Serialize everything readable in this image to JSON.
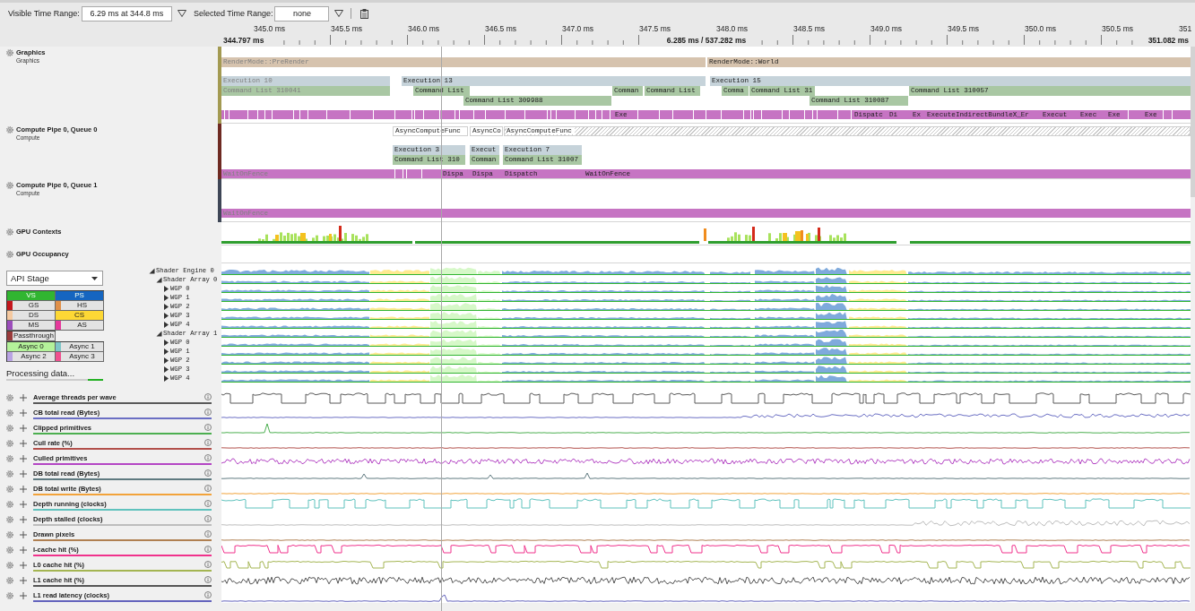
{
  "toolbar": {
    "visible_range": {
      "label": "Visible Time Range:",
      "value": "6.29 ms at 344.8 ms"
    },
    "selected_range": {
      "label": "Selected Time Range:",
      "value": "none"
    }
  },
  "ruler": {
    "ticks": [
      "345.0 ms",
      "345.5 ms",
      "346.0 ms",
      "346.5 ms",
      "347.0 ms",
      "347.5 ms",
      "348.0 ms",
      "348.5 ms",
      "349.0 ms",
      "349.5 ms",
      "350.0 ms",
      "350.5 ms",
      "351"
    ],
    "start": "344.797 ms",
    "span": "6.285 ms / 537.282 ms",
    "end": "351.082 ms"
  },
  "tracks": [
    {
      "kind": "queue",
      "title": "Graphics",
      "subtitle": "Graphics",
      "color": "#a39a52",
      "lanes": [
        {
          "kind": "marker",
          "events": [
            {
              "label": "RenderMode::PreRender",
              "faded": true
            },
            {
              "label": "RenderMode::World",
              "faded": false
            }
          ]
        },
        {
          "kind": "execution",
          "events": [
            {
              "label": "Execution 10",
              "faded": true
            },
            {
              "label": "Execution 13",
              "faded": false
            },
            {
              "label": "Execution 15",
              "faded": false
            }
          ]
        },
        {
          "kind": "command_list",
          "events": [
            {
              "label": "Command List 310041",
              "faded": true
            },
            {
              "label": "Command List",
              "faded": false
            },
            {
              "label": "Comman",
              "faded": false
            },
            {
              "label": "Command List",
              "faded": false
            },
            {
              "label": "Comma",
              "faded": false
            },
            {
              "label": "Command List 31",
              "faded": false
            },
            {
              "label": "Command List 310057",
              "faded": false
            }
          ]
        },
        {
          "kind": "command_list",
          "events": [
            {
              "label": "Command List 309988",
              "faded": false
            },
            {
              "label": "Command List 310087",
              "faded": false
            }
          ]
        },
        {
          "kind": "event",
          "events": [
            {
              "label": "Exe",
              "faded": false
            },
            {
              "label": "Dispatc",
              "faded": false
            },
            {
              "label": "Di",
              "faded": false
            },
            {
              "label": "Ex",
              "faded": false
            },
            {
              "label": "ExecuteIndirectBundleX_Er",
              "faded": false
            },
            {
              "label": "Execut",
              "faded": false
            },
            {
              "label": "Exec",
              "faded": false
            },
            {
              "label": "Exe",
              "faded": false
            },
            {
              "label": "Exe",
              "faded": false
            }
          ]
        }
      ]
    },
    {
      "kind": "queue",
      "title": "Compute Pipe 0, Queue 0",
      "subtitle": "Compute",
      "color": "#6e2a22",
      "lanes": [
        {
          "kind": "queue_function",
          "events": [
            {
              "label": "AsyncComputeFunc",
              "faded": false,
              "hatched": false
            },
            {
              "label": "AsyncCo",
              "faded": false,
              "hatched": false
            },
            {
              "label": "AsyncComputeFunc",
              "faded": false,
              "hatched": true
            }
          ]
        },
        {
          "kind": "execution",
          "events": [
            {
              "label": "Execution 3",
              "faded": false
            },
            {
              "label": "Execut",
              "faded": false
            },
            {
              "label": "Execution 7",
              "faded": false
            }
          ]
        },
        {
          "kind": "command_list",
          "events": [
            {
              "label": "Command List 310",
              "faded": false
            },
            {
              "label": "Comman",
              "faded": false
            },
            {
              "label": "Command List 31007",
              "faded": false
            }
          ]
        },
        {
          "kind": "event",
          "events": [
            {
              "label": "WaitOnFence",
              "faded": true
            },
            {
              "label": "Dispa",
              "faded": false
            },
            {
              "label": "Dispa",
              "faded": false
            },
            {
              "label": "Dispatch",
              "faded": false
            },
            {
              "label": "WaitOnFence",
              "faded": false
            }
          ]
        }
      ]
    },
    {
      "kind": "queue",
      "title": "Compute Pipe 0, Queue 1",
      "subtitle": "Compute",
      "color": "#3e4656",
      "lanes": [
        {
          "kind": "event",
          "events": [
            {
              "label": "WaitOnFence",
              "faded": true
            }
          ]
        }
      ]
    },
    {
      "kind": "contexts",
      "title": "GPU Contexts"
    },
    {
      "kind": "occupancy",
      "title": "GPU Occupancy"
    }
  ],
  "occupancy": {
    "mode": {
      "value": "API Stage"
    },
    "legend": [
      [
        {
          "label": "VS",
          "color": "#31b531",
          "selected": true
        },
        {
          "label": "PS",
          "color": "#1565c0",
          "selected": true
        },
        {
          "label": "GS",
          "color": "#c4161c",
          "selected": false
        },
        {
          "label": "HS",
          "color": "#e0904a",
          "selected": false
        },
        {
          "label": "DS",
          "color": "#f5c9a0",
          "selected": false
        },
        {
          "label": "CS",
          "color": "#fdd835",
          "selected": true
        },
        {
          "label": "MS",
          "color": "#9c4dbb",
          "selected": false
        },
        {
          "label": "AS",
          "color": "#e6399b",
          "selected": false
        }
      ],
      [
        {
          "label": "Passthrough",
          "color": "#9a3b3b",
          "selected": false
        }
      ],
      [
        {
          "label": "Async 0",
          "color": "#b4f29a",
          "selected": true
        },
        {
          "label": "Async 1",
          "color": "#7fc6c8",
          "selected": false
        },
        {
          "label": "Async 2",
          "color": "#b9a3e3",
          "selected": false
        },
        {
          "label": "Async 3",
          "color": "#f0508f",
          "selected": false
        }
      ]
    ],
    "status": {
      "label": "Processing data...",
      "level": 0.16
    },
    "tree": [
      {
        "label": "Shader Engine 0",
        "expanded": true,
        "children": [
          {
            "label": "Shader Array 0",
            "expanded": true,
            "children": [
              {
                "label": "WGP 0",
                "expanded": false
              },
              {
                "label": "WGP 1",
                "expanded": false
              },
              {
                "label": "WGP 2",
                "expanded": false
              },
              {
                "label": "WGP 3",
                "expanded": false
              },
              {
                "label": "WGP 4",
                "expanded": false
              }
            ]
          },
          {
            "label": "Shader Array 1",
            "expanded": true,
            "children": [
              {
                "label": "WGP 0",
                "expanded": false
              },
              {
                "label": "WGP 1",
                "expanded": false
              },
              {
                "label": "WGP 2",
                "expanded": false
              },
              {
                "label": "WGP 3",
                "expanded": false
              },
              {
                "label": "WGP 4",
                "expanded": false
              }
            ]
          }
        ]
      }
    ]
  },
  "counters": [
    {
      "label": "Average threads per wave",
      "color": "#5a5a5a"
    },
    {
      "label": "CB total read (Bytes)",
      "color": "#6b6fc4"
    },
    {
      "label": "Clipped primitives",
      "color": "#4caf50"
    },
    {
      "label": "Cull rate (%)",
      "color": "#b2504b"
    },
    {
      "label": "Culled primitives",
      "color": "#b445c4"
    },
    {
      "label": "DB total read (Bytes)",
      "color": "#5f7a80"
    },
    {
      "label": "DB total write (Bytes)",
      "color": "#f2a33a"
    },
    {
      "label": "Depth running (clocks)",
      "color": "#5fc2bd"
    },
    {
      "label": "Depth stalled (clocks)",
      "color": "#bdbdbd"
    },
    {
      "label": "Drawn pixels",
      "color": "#b08052"
    },
    {
      "label": "I-cache hit (%)",
      "color": "#f0328c"
    },
    {
      "label": "L0 cache hit (%)",
      "color": "#a4b552"
    },
    {
      "label": "L1 cache hit (%)",
      "color": "#555555"
    },
    {
      "label": "L1 read latency (clocks)",
      "color": "#6464bd"
    }
  ]
}
